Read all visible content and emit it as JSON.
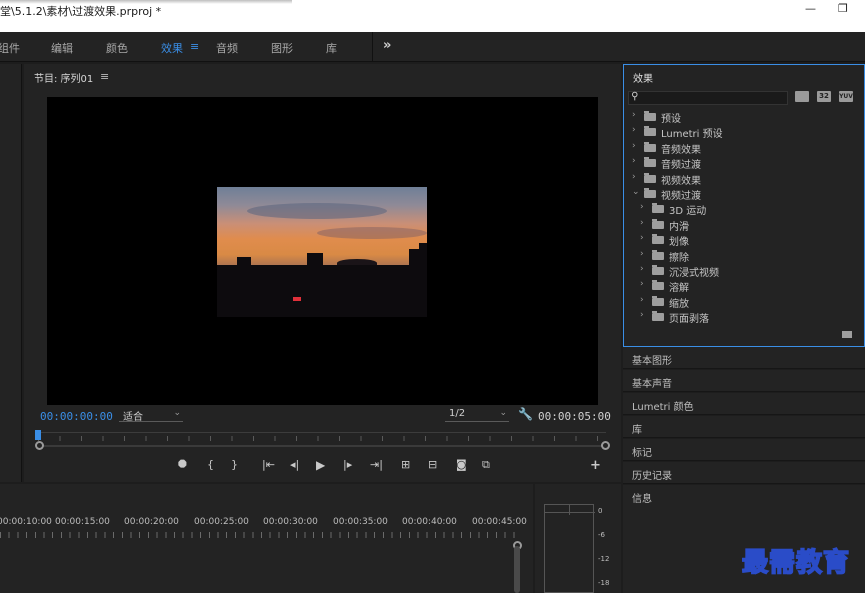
{
  "window": {
    "title": "堂\\5.1.2\\素材\\过渡效果.prproj *",
    "minimize_glyph": "—",
    "restore_glyph": "❐"
  },
  "workspaces": {
    "items": [
      "组件",
      "编辑",
      "颜色",
      "效果",
      "音频",
      "图形",
      "库"
    ],
    "active": "效果",
    "menu_glyph": "≡",
    "more_glyph": "»",
    "accent_color": "#3a8ee6"
  },
  "program_monitor": {
    "title": "节目: 序列01",
    "menu_glyph": "≡",
    "timecode_current": "00:00:00:00",
    "fit_label": "适合",
    "resolution_label": "1/2",
    "timecode_duration": "00:00:05:00",
    "transport_icons": [
      "marker-icon",
      "mark-in-icon",
      "mark-out-icon",
      "go-to-in-icon",
      "step-back-icon",
      "play-icon",
      "step-forward-icon",
      "go-to-out-icon",
      "lift-icon",
      "extract-icon",
      "export-frame-icon",
      "comparison-view-icon",
      "add-button-icon"
    ]
  },
  "effects_panel": {
    "title": "效果",
    "tree": [
      {
        "label": "预设",
        "expanded": false,
        "level": 0,
        "icon": "preset-folder-icon"
      },
      {
        "label": "Lumetri 预设",
        "expanded": false,
        "level": 0,
        "icon": "preset-folder-icon"
      },
      {
        "label": "音频效果",
        "expanded": false,
        "level": 0,
        "icon": "folder-icon"
      },
      {
        "label": "音频过渡",
        "expanded": false,
        "level": 0,
        "icon": "folder-icon"
      },
      {
        "label": "视频效果",
        "expanded": false,
        "level": 0,
        "icon": "folder-icon"
      },
      {
        "label": "视频过渡",
        "expanded": true,
        "level": 0,
        "icon": "folder-icon"
      },
      {
        "label": "3D 运动",
        "expanded": false,
        "level": 1,
        "icon": "folder-icon"
      },
      {
        "label": "内滑",
        "expanded": false,
        "level": 1,
        "icon": "folder-icon"
      },
      {
        "label": "划像",
        "expanded": false,
        "level": 1,
        "icon": "folder-icon"
      },
      {
        "label": "擦除",
        "expanded": false,
        "level": 1,
        "icon": "folder-icon"
      },
      {
        "label": "沉浸式视频",
        "expanded": false,
        "level": 1,
        "icon": "folder-icon"
      },
      {
        "label": "溶解",
        "expanded": false,
        "level": 1,
        "icon": "folder-icon"
      },
      {
        "label": "缩放",
        "expanded": false,
        "level": 1,
        "icon": "folder-icon"
      },
      {
        "label": "页面剥落",
        "expanded": false,
        "level": 1,
        "icon": "folder-icon"
      }
    ],
    "filter_icons": [
      "accelerated-effects-icon",
      "32-bit-icon",
      "yuv-icon"
    ],
    "filter_icon_labels": [
      "",
      "32",
      "YUV"
    ]
  },
  "collapsed_panels": [
    "基本图形",
    "基本声音",
    "Lumetri 颜色",
    "库",
    "标记",
    "历史记录",
    "信息"
  ],
  "timeline": {
    "ruler_labels": [
      "00:00:10:00",
      "00:00:15:00",
      "00:00:20:00",
      "00:00:25:00",
      "00:00:30:00",
      "00:00:35:00",
      "00:00:40:00",
      "00:00:45:00"
    ]
  },
  "audio_meter": {
    "labels": [
      "0",
      "-6",
      "-12",
      "-18"
    ]
  },
  "watermark": {
    "text": "最需教育"
  }
}
